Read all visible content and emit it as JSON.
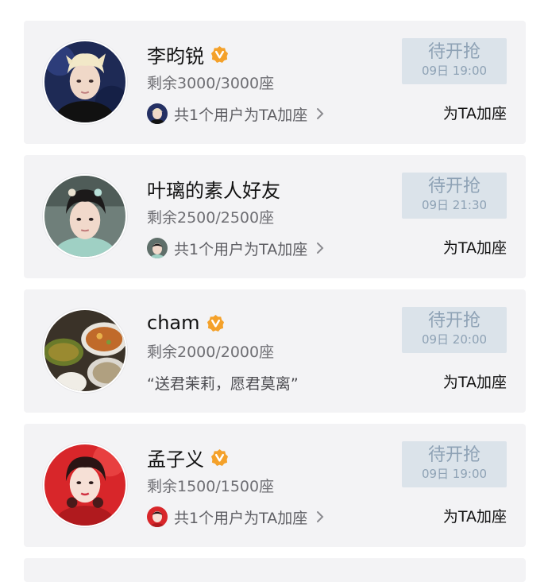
{
  "theme": {
    "card_bg": "#f3f3f5",
    "pending_bg": "#dbe3ea",
    "pending_text": "#8ea2b5",
    "verified": "#f4a12a"
  },
  "items": [
    {
      "name": "李昀锐",
      "verified": true,
      "seats": "剩余3000/3000座",
      "line3": "共1个用户为TA加座",
      "status_label": "待开抢",
      "status_time": "09日 19:00",
      "action": "为TA加座"
    },
    {
      "name": "叶璃的素人好友",
      "verified": false,
      "seats": "剩余2500/2500座",
      "line3": "共1个用户为TA加座",
      "status_label": "待开抢",
      "status_time": "09日 21:30",
      "action": "为TA加座"
    },
    {
      "name": "cham",
      "verified": true,
      "seats": "剩余2000/2000座",
      "line3": "“送君茉莉，愿君莫离”",
      "status_label": "待开抢",
      "status_time": "09日 20:00",
      "action": "为TA加座"
    },
    {
      "name": "孟子义",
      "verified": true,
      "seats": "剩余1500/1500座",
      "line3": "共1个用户为TA加座",
      "status_label": "待开抢",
      "status_time": "09日 19:00",
      "action": "为TA加座"
    }
  ]
}
